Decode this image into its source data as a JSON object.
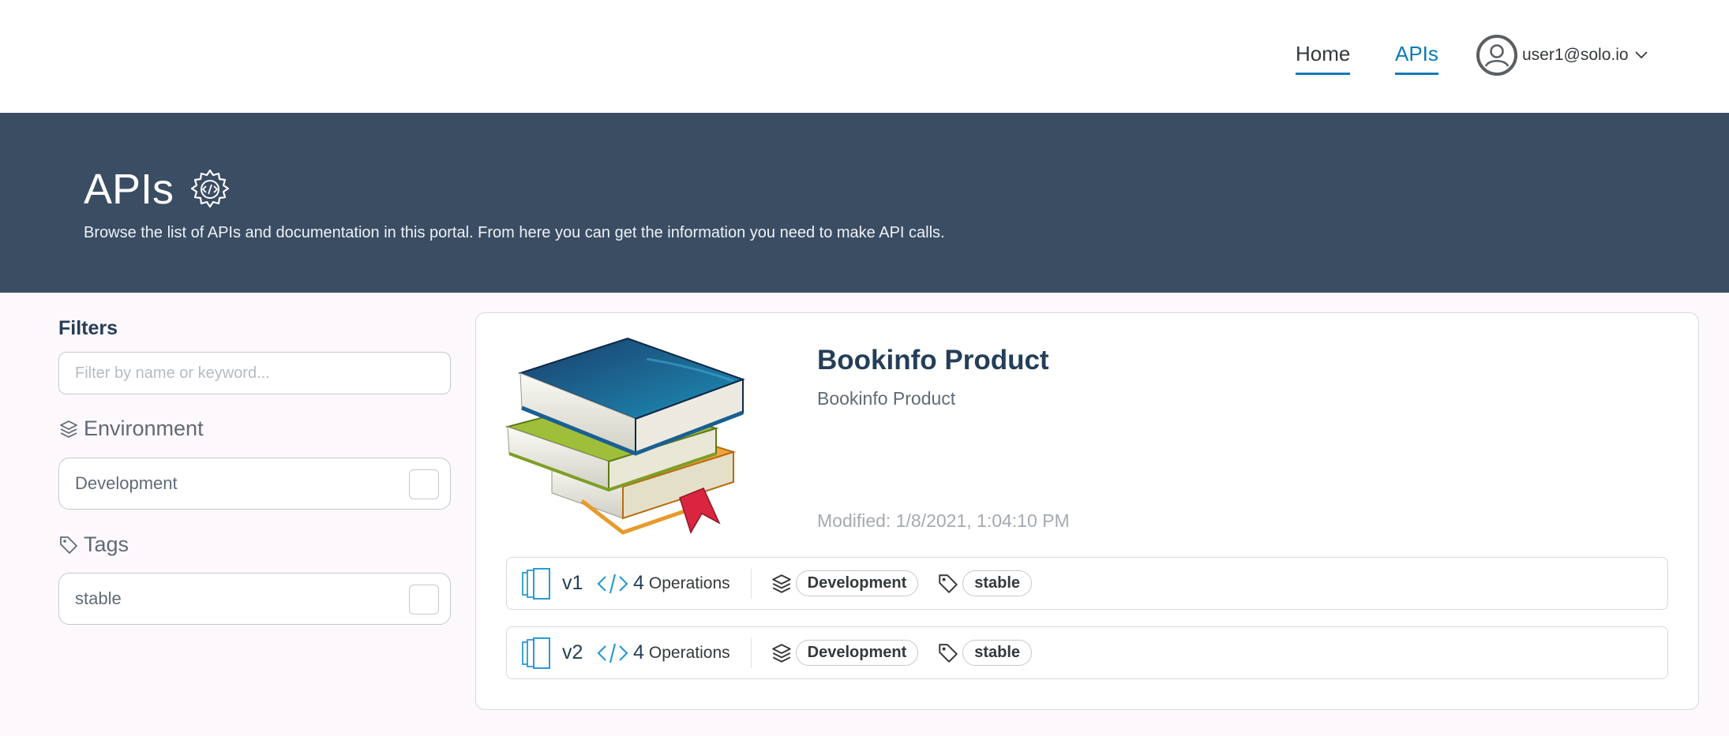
{
  "nav": {
    "home": "Home",
    "apis": "APIs",
    "user": "user1@solo.io",
    "accent": "#0d7ab8"
  },
  "hero": {
    "title": "APIs",
    "description": "Browse the list of APIs and documentation in this portal. From here you can get the information you need to make API calls.",
    "background": "#3a4d63"
  },
  "filters": {
    "title": "Filters",
    "search_placeholder": "Filter by name or keyword...",
    "environment_label": "Environment",
    "environments": [
      {
        "label": "Development",
        "checked": false
      }
    ],
    "tags_label": "Tags",
    "tags": [
      {
        "label": "stable",
        "checked": false
      }
    ]
  },
  "api_card": {
    "title": "Bookinfo Product",
    "description": "Bookinfo Product",
    "modified": "Modified: 1/8/2021, 1:04:10 PM",
    "image_icon": "books-icon",
    "versions": [
      {
        "name": "v1",
        "operation_count": "4",
        "operation_label": "Operations",
        "environment": "Development",
        "tag": "stable"
      },
      {
        "name": "v2",
        "operation_count": "4",
        "operation_label": "Operations",
        "environment": "Development",
        "tag": "stable"
      }
    ]
  }
}
